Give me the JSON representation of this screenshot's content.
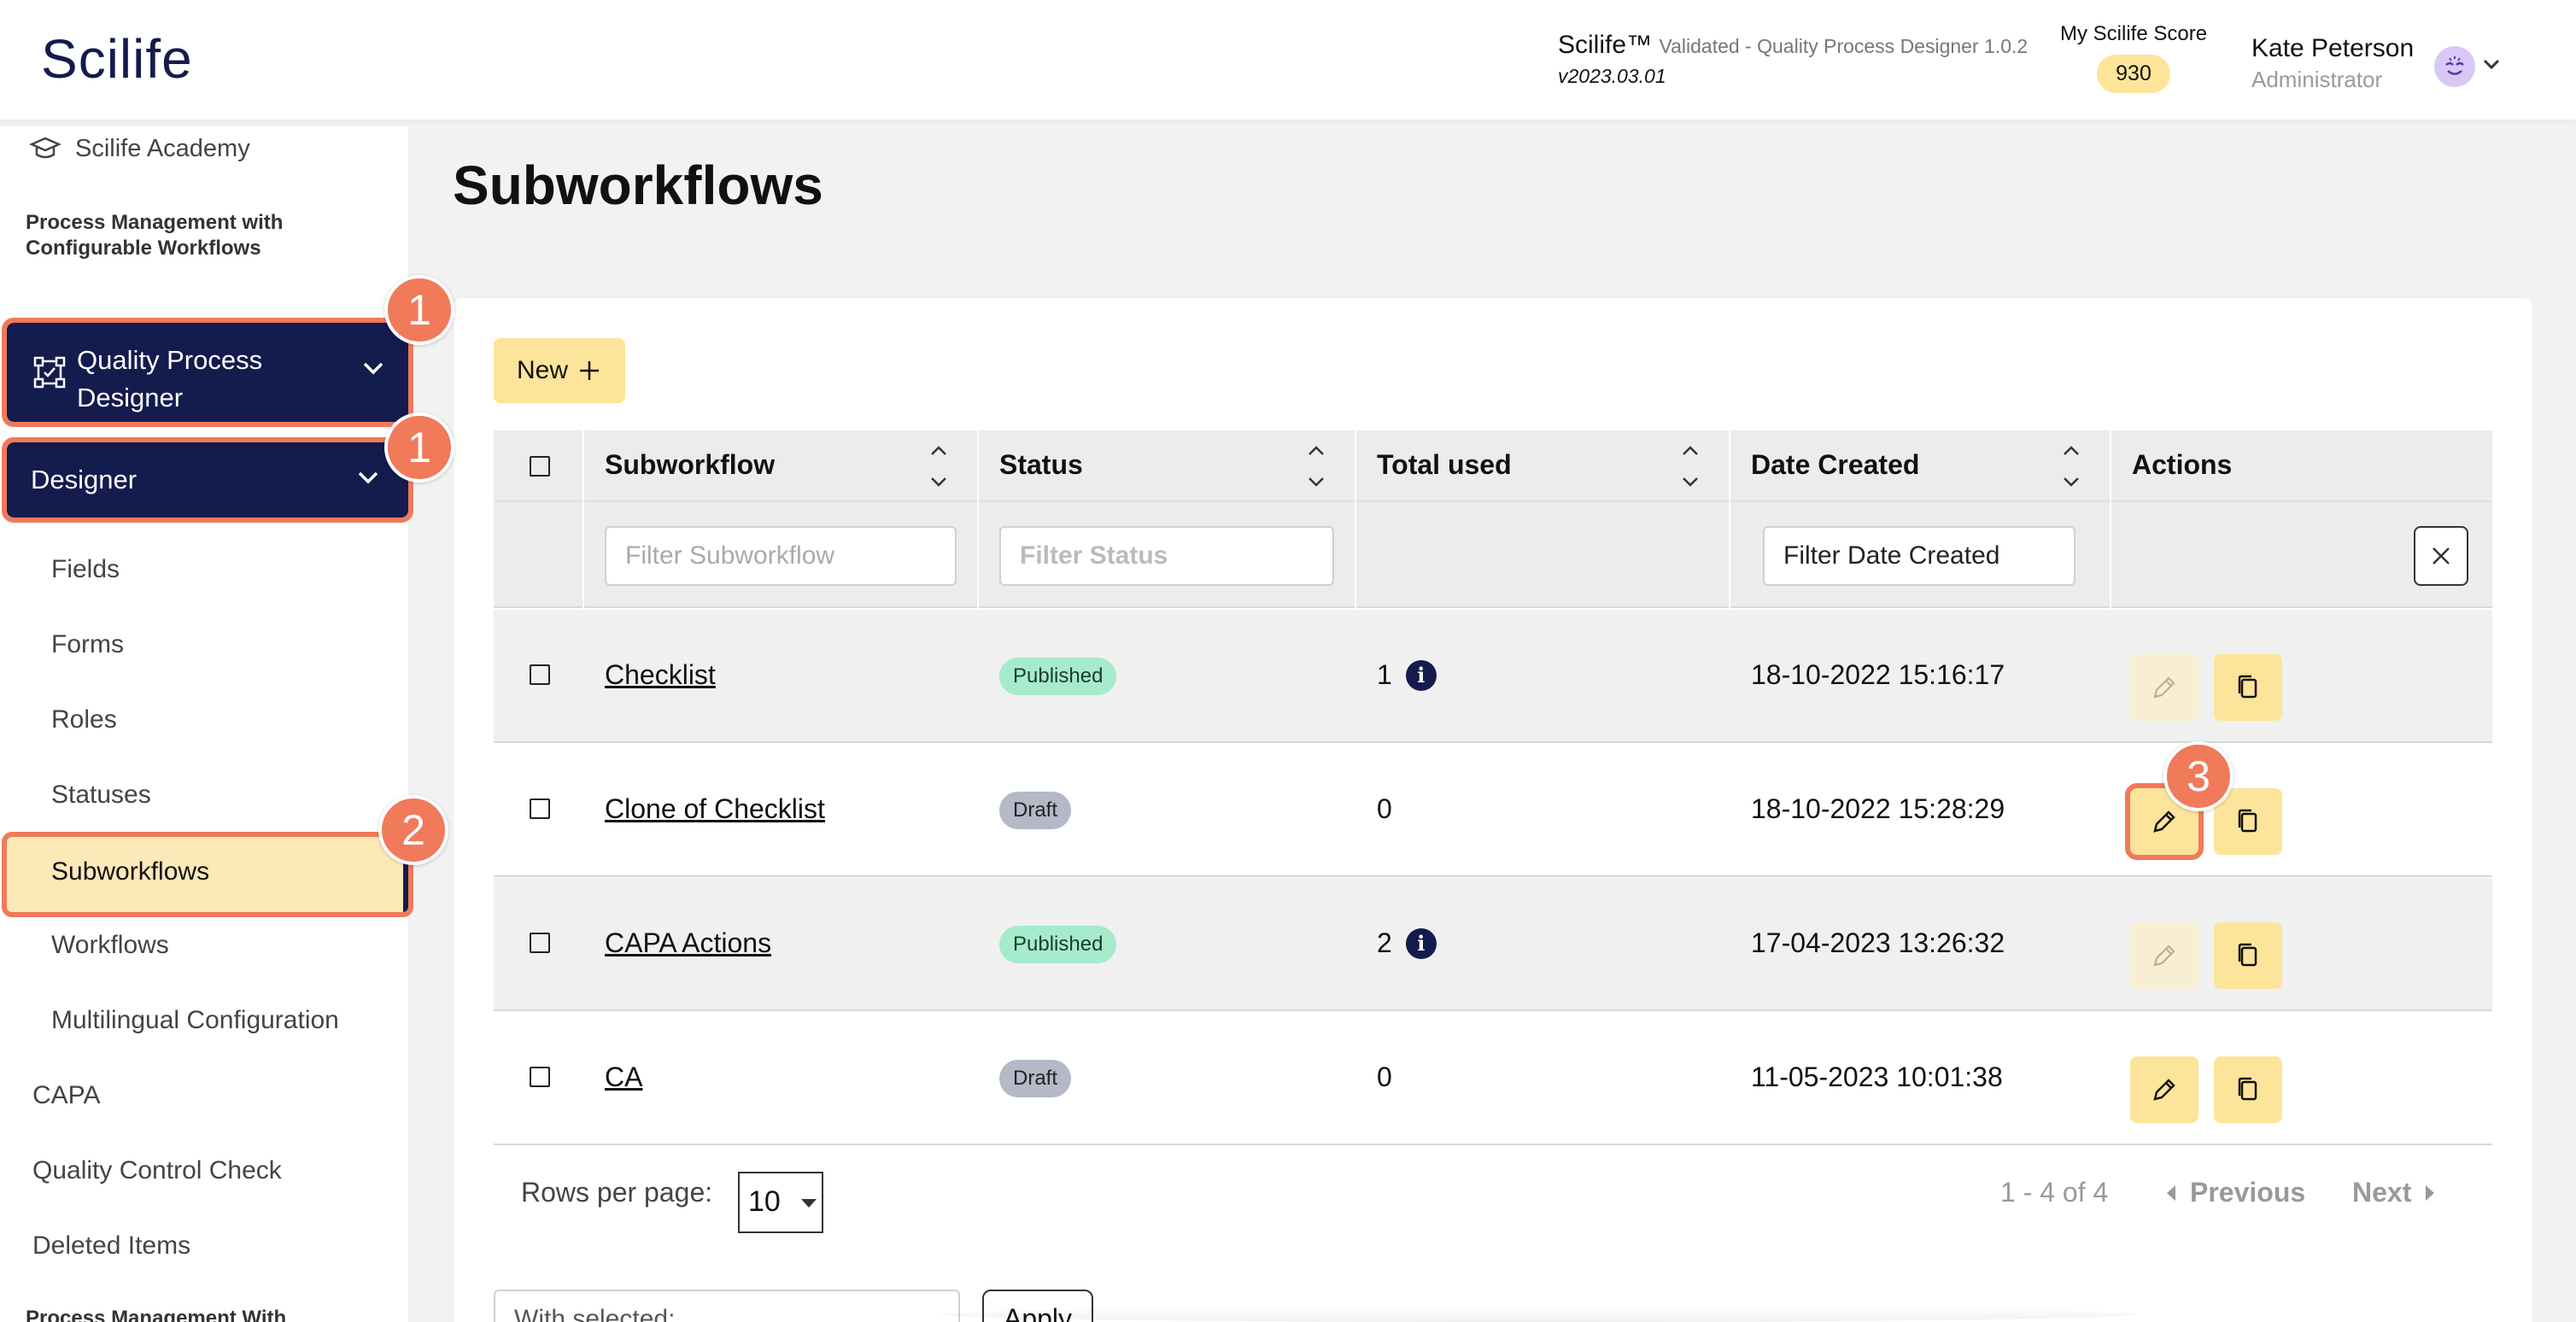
{
  "header": {
    "logo": "Scilife",
    "app_name": "Scilife™",
    "app_subtitle": "Validated - Quality Process Designer 1.0.2",
    "app_version": "v2023.03.01",
    "score_label": "My Scilife Score",
    "score_value": "930",
    "user_name": "Kate Peterson",
    "user_role": "Administrator"
  },
  "sidebar": {
    "academy": "Scilife Academy",
    "section_title": "Process Management with Configurable Workflows",
    "qpd_label": "Quality Process Designer",
    "designer_label": "Designer",
    "sub_items": [
      "Fields",
      "Forms",
      "Roles",
      "Statuses",
      "Subworkflows",
      "Workflows",
      "Multilingual Configuration"
    ],
    "top_items": [
      "CAPA",
      "Quality Control Check",
      "Deleted Items"
    ],
    "cut_off_title": "Process Management With"
  },
  "callouts": [
    "1",
    "1",
    "2",
    "3"
  ],
  "main": {
    "title": "Subworkflows",
    "new_button": "New"
  },
  "table": {
    "headers": [
      "Subworkflow",
      "Status",
      "Total used",
      "Date Created",
      "Actions"
    ],
    "filters": {
      "subworkflow_placeholder": "Filter Subworkflow",
      "status_placeholder": "Filter Status",
      "date_placeholder": "Filter Date Created"
    },
    "rows": [
      {
        "name": "Checklist",
        "status": "Published",
        "total": "1",
        "has_info": true,
        "date": "18-10-2022 15:16:17",
        "edit_enabled": false
      },
      {
        "name": "Clone of Checklist",
        "status": "Draft",
        "total": "0",
        "has_info": false,
        "date": "18-10-2022 15:28:29",
        "edit_enabled": true
      },
      {
        "name": "CAPA Actions",
        "status": "Published",
        "total": "2",
        "has_info": true,
        "date": "17-04-2023 13:26:32",
        "edit_enabled": false
      },
      {
        "name": "CA",
        "status": "Draft",
        "total": "0",
        "has_info": false,
        "date": "11-05-2023 10:01:38",
        "edit_enabled": true
      }
    ]
  },
  "pagination": {
    "rows_per_page_label": "Rows per page:",
    "rows_per_page_value": "10",
    "range": "1 - 4 of 4",
    "previous": "Previous",
    "next": "Next"
  },
  "bulk": {
    "with_selected": "With selected:",
    "apply": "Apply"
  },
  "colors": {
    "navy": "#141b4d",
    "accent_yellow": "#fce59a",
    "callout": "#f07a5a",
    "published": "#a6ebcb",
    "draft": "#b4b8c7"
  }
}
